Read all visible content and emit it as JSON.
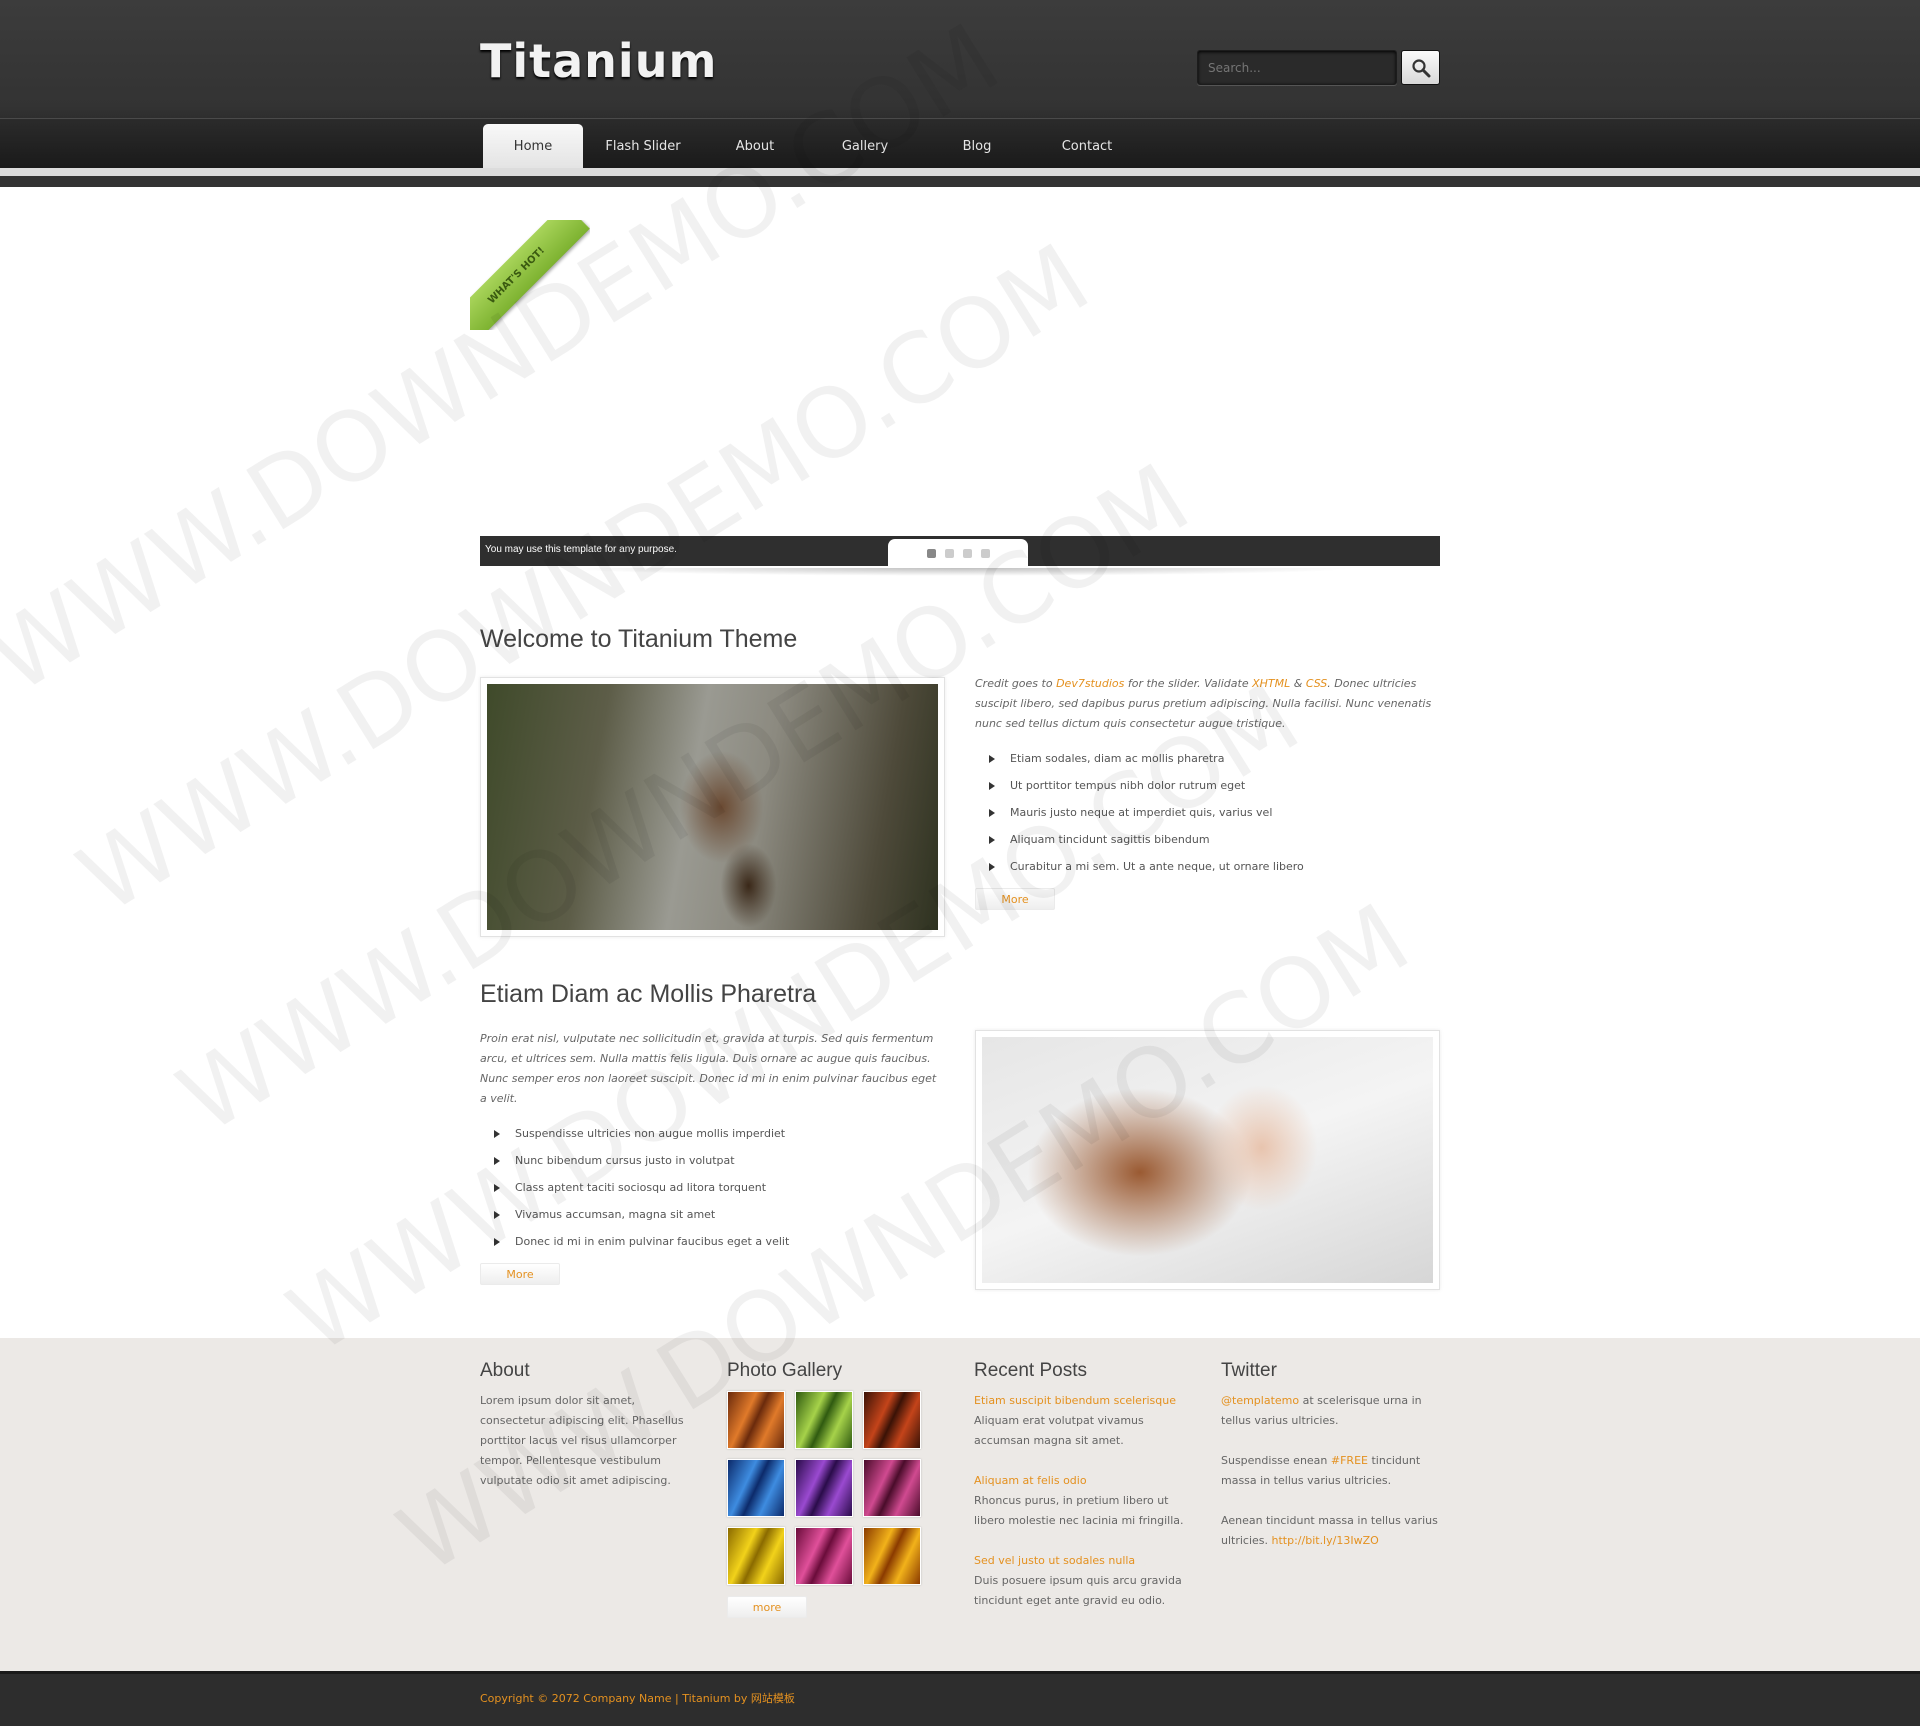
{
  "header": {
    "logo": "Titanium",
    "search": {
      "placeholder": "Search..."
    }
  },
  "nav": [
    {
      "label": "Home",
      "active": true
    },
    {
      "label": "Flash Slider"
    },
    {
      "label": "About"
    },
    {
      "label": "Gallery"
    },
    {
      "label": "Blog"
    },
    {
      "label": "Contact"
    }
  ],
  "slider": {
    "ribbon": "WHAT'S HOT!",
    "caption": "You may use this template for any purpose.",
    "dots": 4,
    "active_dot": 1
  },
  "welcome": {
    "title": "Welcome to Titanium Theme",
    "intro_pre": "Credit goes to ",
    "link1": "Dev7studios",
    "intro_mid1": " for the slider. Validate ",
    "link2": "XHTML",
    "intro_amp": " & ",
    "link3": "CSS",
    "intro_post": ". Donec ultricies suscipit libero, sed dapibus purus pretium adipiscing. Nulla facilisi. Nunc venenatis nunc sed tellus dictum quis consectetur augue tristique.",
    "items": [
      "Etiam sodales, diam ac mollis pharetra",
      "Ut porttitor tempus nibh dolor rutrum eget",
      "Mauris justo neque at imperdiet quis, varius vel",
      "Aliquam tincidunt sagittis bibendum",
      "Curabitur a mi sem. Ut a ante neque, ut ornare libero"
    ],
    "more": "More"
  },
  "section2": {
    "title": "Etiam Diam ac Mollis Pharetra",
    "intro": "Proin erat nisl, vulputate nec sollicitudin et, gravida at turpis. Sed quis fermentum arcu, et ultrices sem. Nulla mattis felis ligula. Duis ornare ac augue quis faucibus. Nunc semper eros non laoreet suscipit. Donec id mi in enim pulvinar faucibus eget a velit.",
    "items": [
      "Suspendisse ultricies non augue mollis imperdiet",
      "Nunc bibendum cursus justo in volutpat",
      "Class aptent taciti sociosqu ad litora torquent",
      "Vivamus accumsan, magna sit amet",
      "Donec id mi in enim pulvinar faucibus eget a velit"
    ],
    "more": "More"
  },
  "footer": {
    "about": {
      "title": "About",
      "text": "Lorem ipsum dolor sit amet, consectetur adipiscing elit. Phasellus porttitor lacus vel risus ullamcorper tempor. Pellentesque vestibulum vulputate odio sit amet adipiscing."
    },
    "gallery": {
      "title": "Photo Gallery",
      "more": "more",
      "thumb_colors": [
        [
          "#6a2a0c",
          "#e07a2a"
        ],
        [
          "#2f5a10",
          "#a6d24a"
        ],
        [
          "#3a1206",
          "#c4441a"
        ],
        [
          "#0c2a6a",
          "#3e8ce0"
        ],
        [
          "#2a0c4a",
          "#9a4ad0"
        ],
        [
          "#4a0c2a",
          "#d04a90"
        ],
        [
          "#8a6a00",
          "#f2d21a"
        ],
        [
          "#6a0c3a",
          "#e0509a"
        ],
        [
          "#8a3a00",
          "#f2b21a"
        ]
      ]
    },
    "posts": {
      "title": "Recent Posts",
      "items": [
        {
          "link": "Etiam suscipit bibendum scelerisque",
          "text": "Aliquam erat volutpat vivamus accumsan magna sit amet."
        },
        {
          "link": "Aliquam at felis odio",
          "text": "Rhoncus purus, in pretium libero ut libero molestie nec lacinia mi fringilla."
        },
        {
          "link": "Sed vel justo ut sodales nulla",
          "text": "Duis posuere ipsum quis arcu gravida tincidunt eget ante gravid eu odio."
        }
      ]
    },
    "twitter": {
      "title": "Twitter",
      "t1_link": "@templatemo",
      "t1_text": " at scelerisque urna in tellus varius ultricies.",
      "t2_pre": "Suspendisse enean ",
      "t2_link": "#FREE",
      "t2_post": " tincidunt massa in tellus varius ultricies.",
      "t3_pre": "Aenean tincidunt massa in tellus varius ultricies. ",
      "t3_link": "http://bit.ly/13IwZO"
    }
  },
  "copyright": "Copyright © 2072 Company Name | Titanium by 网站模板",
  "watermark": "WWW.DOWNDEMO.COM",
  "colors": {
    "accent": "#e49120",
    "header": "#333333",
    "footer": "#ece9e6"
  }
}
